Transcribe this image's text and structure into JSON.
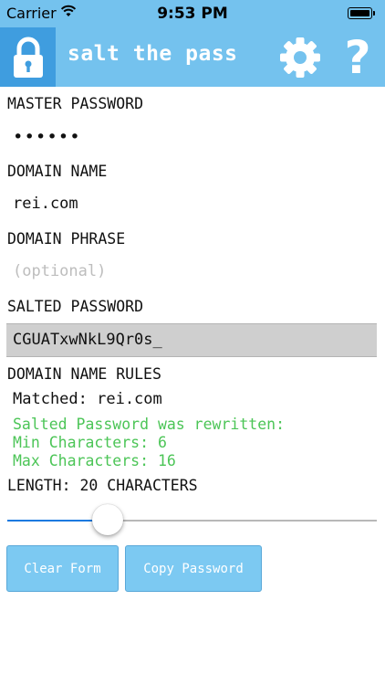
{
  "status_bar": {
    "carrier": "Carrier",
    "time": "9:53 PM",
    "battery_level": 1.0
  },
  "nav": {
    "title": "salt the pass",
    "help_glyph": "?",
    "icons": [
      "lock-icon",
      "gear-icon",
      "help-icon"
    ],
    "background": "#74c2ee",
    "lock_background": "#3f9ddf"
  },
  "form": {
    "master_password_label": "MASTER PASSWORD",
    "master_password_value": "••••••",
    "domain_name_label": "DOMAIN NAME",
    "domain_name_value": "rei.com",
    "domain_phrase_label": "DOMAIN PHRASE",
    "domain_phrase_placeholder": "(optional)",
    "salted_password_label": "SALTED PASSWORD",
    "salted_password_value": "CGUATxwNkL9Qr0s_",
    "rules_label": "DOMAIN NAME RULES",
    "rules_matched": "Matched: rei.com",
    "rules_rewritten": "Salted Password was rewritten:",
    "rules_min": "Min Characters: 6",
    "rules_max": "Max Characters: 16",
    "length_label": "LENGTH: 20 CHARACTERS",
    "length_slider_fraction": 0.25,
    "accent_green": "#4cc557"
  },
  "buttons": {
    "clear_form": "Clear Form",
    "copy_password": "Copy Password",
    "color": "#7cc9f2"
  }
}
